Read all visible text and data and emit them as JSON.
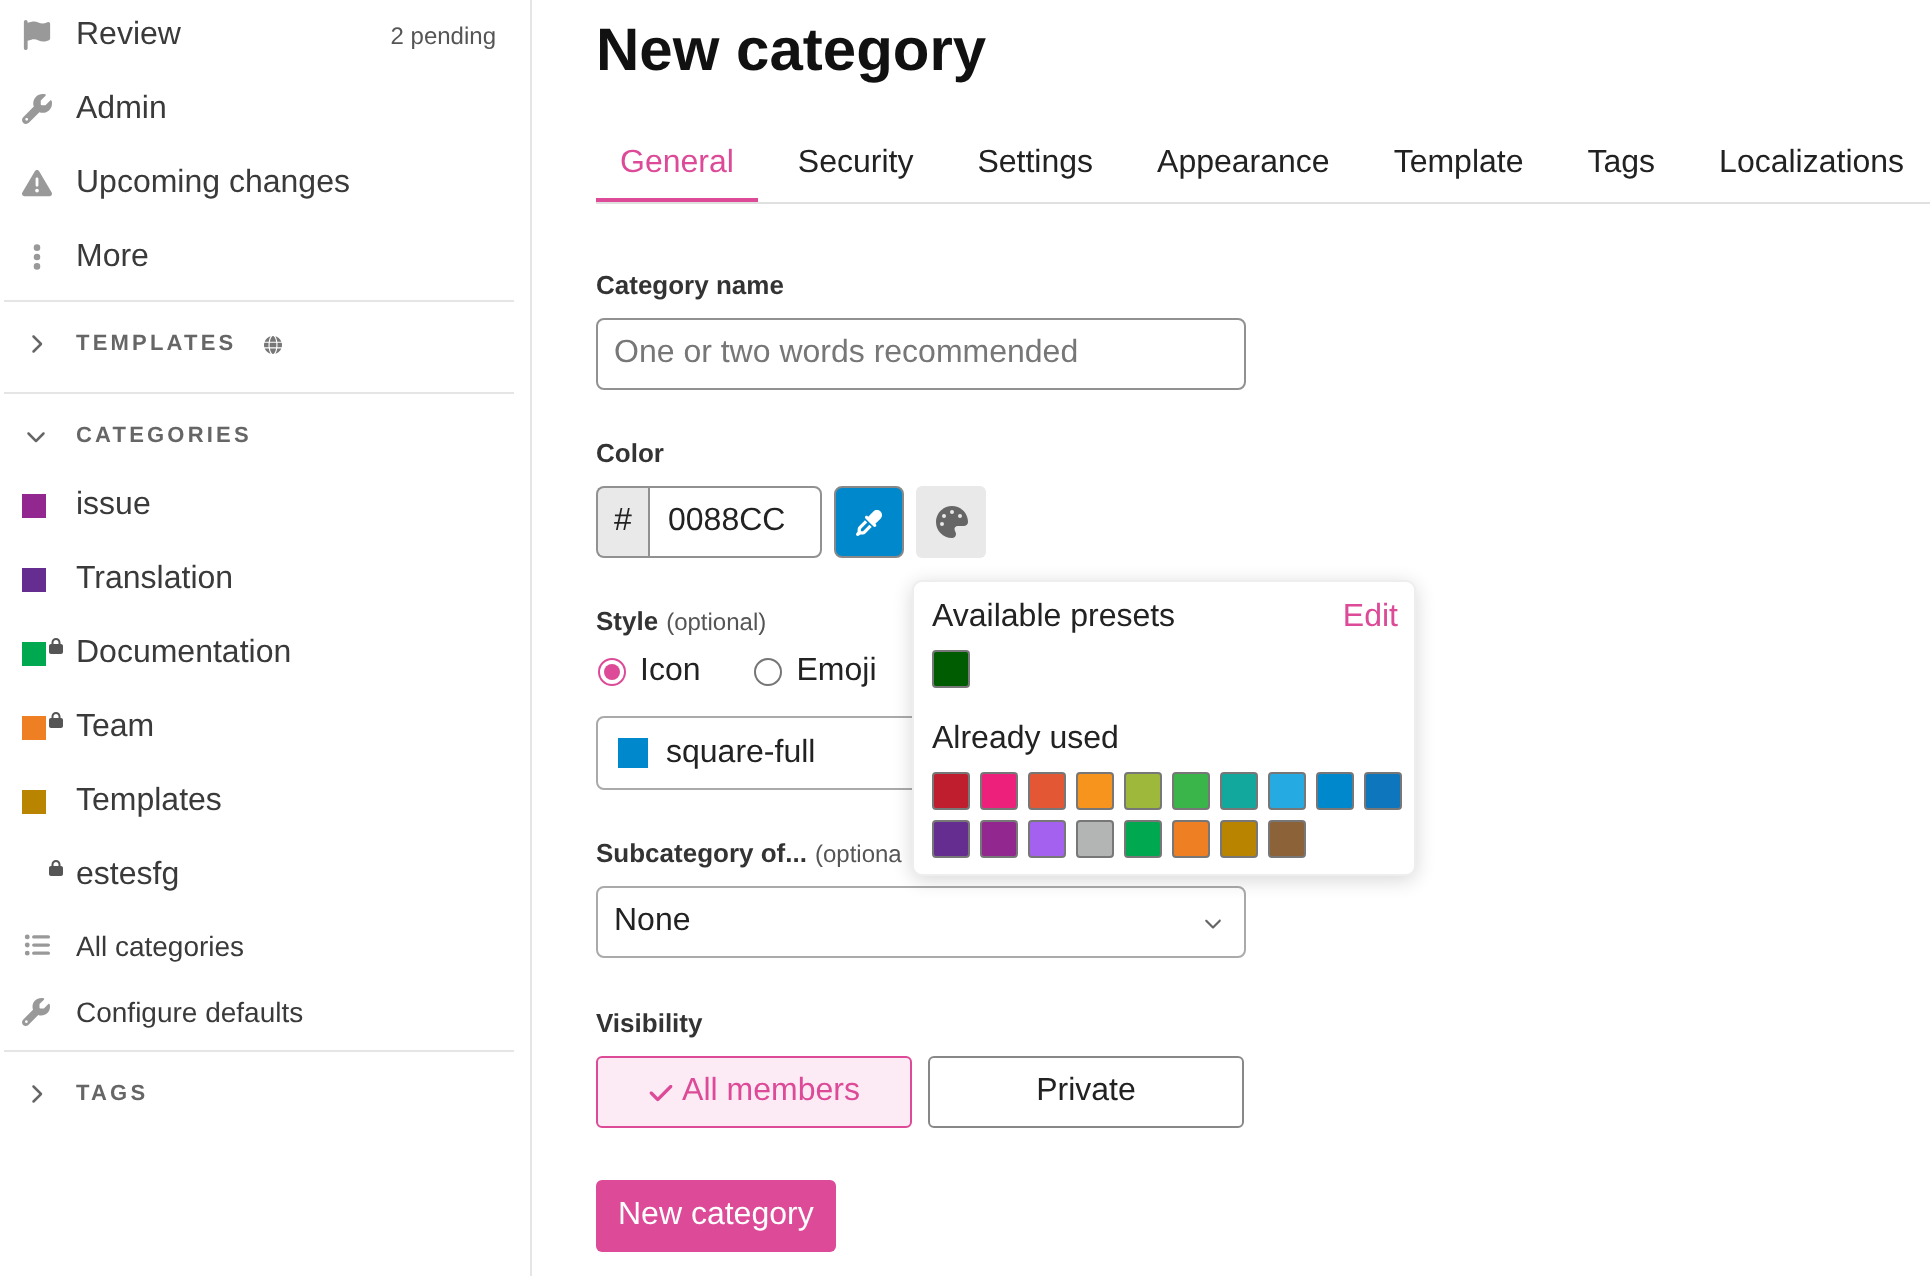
{
  "sidebar": {
    "links": [
      {
        "label": "Review",
        "badge": "2 pending"
      },
      {
        "label": "Admin"
      },
      {
        "label": "Upcoming changes"
      },
      {
        "label": "More"
      }
    ],
    "sections": [
      {
        "title": "TEMPLATES",
        "expanded": false
      },
      {
        "title": "CATEGORIES",
        "expanded": true,
        "items": [
          {
            "label": "issue",
            "color": "#92278f",
            "locked": false
          },
          {
            "label": "Translation",
            "color": "#652d90",
            "locked": false
          },
          {
            "label": "Documentation",
            "color": "#00a94f",
            "locked": true
          },
          {
            "label": "Team",
            "color": "#ee7f22",
            "locked": true
          },
          {
            "label": "Templates",
            "color": "#b98400",
            "locked": false
          },
          {
            "label": "estesfg",
            "locked": true
          }
        ],
        "links": [
          {
            "label": "All categories"
          },
          {
            "label": "Configure defaults"
          }
        ]
      },
      {
        "title": "TAGS",
        "expanded": false
      }
    ]
  },
  "page": {
    "title": "New category"
  },
  "tabs": [
    {
      "label": "General",
      "selected": true
    },
    {
      "label": "Security",
      "selected": false
    },
    {
      "label": "Settings",
      "selected": false
    },
    {
      "label": "Appearance",
      "selected": false
    },
    {
      "label": "Template",
      "selected": false
    },
    {
      "label": "Tags",
      "selected": false
    },
    {
      "label": "Localizations",
      "selected": false
    }
  ],
  "form": {
    "category_name": {
      "label": "Category name",
      "placeholder": "One or two words recommended"
    },
    "color": {
      "label": "Color",
      "prefix": "#",
      "value": "0088CC"
    },
    "style": {
      "label": "Style",
      "note": "(optional)",
      "options": [
        {
          "label": "Icon",
          "selected": true
        },
        {
          "label": "Emoji",
          "selected": false
        }
      ],
      "value": "square-full"
    },
    "parent": {
      "label": "Subcategory of...",
      "note": "(optiona",
      "value": "None"
    },
    "visibility": {
      "label": "Visibility",
      "options": [
        {
          "label": "All members",
          "selected": true
        },
        {
          "label": "Private",
          "selected": false
        }
      ]
    },
    "submit": "New category"
  },
  "color_picker": {
    "presets_title": "Available presets",
    "edit": "Edit",
    "presets": [
      {
        "color": "#005c00"
      }
    ],
    "used_title": "Already used",
    "used": [
      {
        "color": "#bf1e2e"
      },
      {
        "color": "#ed207b"
      },
      {
        "color": "#e45735"
      },
      {
        "color": "#f7941d"
      },
      {
        "color": "#9eb83b"
      },
      {
        "color": "#3ab54a"
      },
      {
        "color": "#12a89d"
      },
      {
        "color": "#25aae2"
      },
      {
        "color": "#0088cc"
      },
      {
        "color": "#0e76bd"
      },
      {
        "color": "#652d90"
      },
      {
        "color": "#92278f"
      },
      {
        "color": "#a461ef"
      },
      {
        "color": "#b3b5b4"
      },
      {
        "color": "#00a94f"
      },
      {
        "color": "#ee7f22"
      },
      {
        "color": "#b98400"
      },
      {
        "color": "#8c6238"
      }
    ]
  }
}
